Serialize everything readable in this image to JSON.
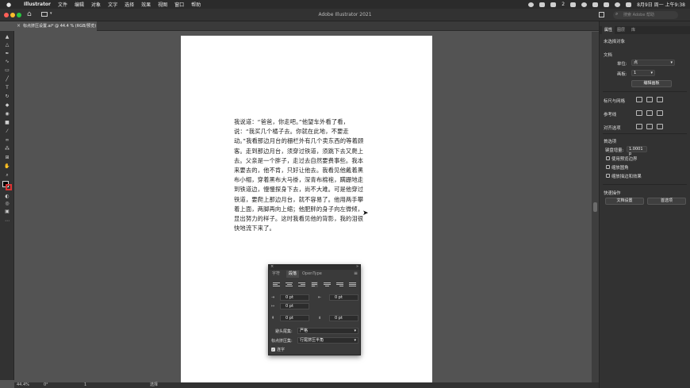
{
  "menubar": {
    "app_name": "Illustrator",
    "items": [
      "文件",
      "编辑",
      "对象",
      "文字",
      "选择",
      "效果",
      "视图",
      "窗口",
      "帮助"
    ],
    "badge": "2",
    "datetime": "8月9日 周一 上午9:38"
  },
  "appbar": {
    "title": "Adobe Illustrator 2021",
    "search_placeholder": "搜索 Adobe 帮助"
  },
  "doc_tab": {
    "name": "标点挤压设置.ai* @ 44.4 % (RGB/预览)"
  },
  "document": {
    "paragraph": "我说道：“爸爸，你走吧。”他望车外看了看，说：“我买几个橘子去。你就在此地，不要走动。”我看那边月台的栅栏外有几个卖东西的等着顾客。走到那边月台，须穿过铁道，须跳下去又爬上去。父亲是一个胖子，走过去自然要费事些。我本来要去的，他不肯，只好让他去。我看见他戴着黑布小帽，穿着黑布大马褂，深青布棉袍，蹒跚地走到铁道边，慢慢探身下去，尚不大难。可是他穿过铁道，要爬上那边月台，就不容易了。他用两手攀着上面，两脚再向上缩；他肥胖的身子向左微倾，显出努力的样子。这时我看见他的背影，我的泪很快地流下来了。"
  },
  "statusbar": {
    "zoom": "44.4%",
    "rotation": "0°",
    "artboard": "1",
    "tool": "选择"
  },
  "right_panel": {
    "tabs": [
      "属性",
      "图层",
      "库"
    ],
    "no_selection": "未选择对象",
    "document_section": "文档",
    "units_label": "单位:",
    "units_value": "点",
    "artboard_label": "画板:",
    "artboard_value": "1",
    "edit_artboard_button": "编辑画板",
    "rulers_grids": "标尺与网格",
    "guides": "参考线",
    "align_options": "对齐选项",
    "preferences": "首选项",
    "keyboard_increment_label": "键盘增量:",
    "keyboard_increment_value": "1.0001 p",
    "checkbox_1": "使用预览边界",
    "checkbox_2": "缩放圆角",
    "checkbox_3": "缩放描边和效果",
    "quick_actions": "快速操作",
    "doc_setup_button": "文档设置",
    "prefs_button": "首选项"
  },
  "floating_panel": {
    "tabs": [
      "字符",
      "段落",
      "OpenType"
    ],
    "left_indent": "0 pt",
    "right_indent": "0 pt",
    "first_line_indent": "0 pt",
    "space_before": "0 pt",
    "space_after": "0 pt",
    "kinsoku_label": "避头尾集:",
    "kinsoku_value": "严格",
    "mojikumi_label": "标点挤压集:",
    "mojikumi_value": "行尾挤压半角",
    "hyphenate_label": "连字"
  },
  "colors": {
    "accent": "#2b7de9",
    "panel_bg": "#323232",
    "canvas_bg": "#535353"
  }
}
